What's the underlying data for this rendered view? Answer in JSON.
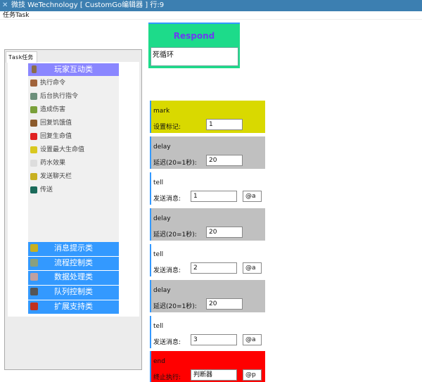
{
  "window": {
    "title": "微技 WeTechnology [ CustomGo编辑器 ]   行:9"
  },
  "menu": {
    "label": "任务Task"
  },
  "panel": {
    "tab": "Task任务",
    "header": "玩家互动类",
    "items": [
      "执行命令",
      "后台执行指令",
      "造成伤害",
      "回复饥饿值",
      "回复生命值",
      "设置最大生命值",
      "药水效果",
      "发送聊天栏",
      "传送"
    ],
    "categories": [
      "消息提示类",
      "流程控制类",
      "数据处理类",
      "队列控制类",
      "扩展支持类"
    ]
  },
  "respond": {
    "title": "Respond",
    "value": "死循环"
  },
  "blocks": [
    {
      "name": "mark",
      "label": "设置标记:",
      "value": "1",
      "color": "#d9d900"
    },
    {
      "name": "delay",
      "label": "延迟(20=1秒):",
      "value": "20",
      "color": "#c0c0c0"
    },
    {
      "name": "tell",
      "label": "发送消息:",
      "value": "1",
      "target": "@a",
      "color": "#ffffff"
    },
    {
      "name": "delay",
      "label": "延迟(20=1秒):",
      "value": "20",
      "color": "#c0c0c0"
    },
    {
      "name": "tell",
      "label": "发送消息:",
      "value": "2",
      "target": "@a",
      "color": "#ffffff"
    },
    {
      "name": "delay",
      "label": "延迟(20=1秒):",
      "value": "20",
      "color": "#c0c0c0"
    },
    {
      "name": "tell",
      "label": "发送消息:",
      "value": "3",
      "target": "@a",
      "color": "#ffffff"
    },
    {
      "name": "end",
      "label": "终止执行:",
      "value": "判断器",
      "target": "@p",
      "color": "#ff0000"
    }
  ]
}
